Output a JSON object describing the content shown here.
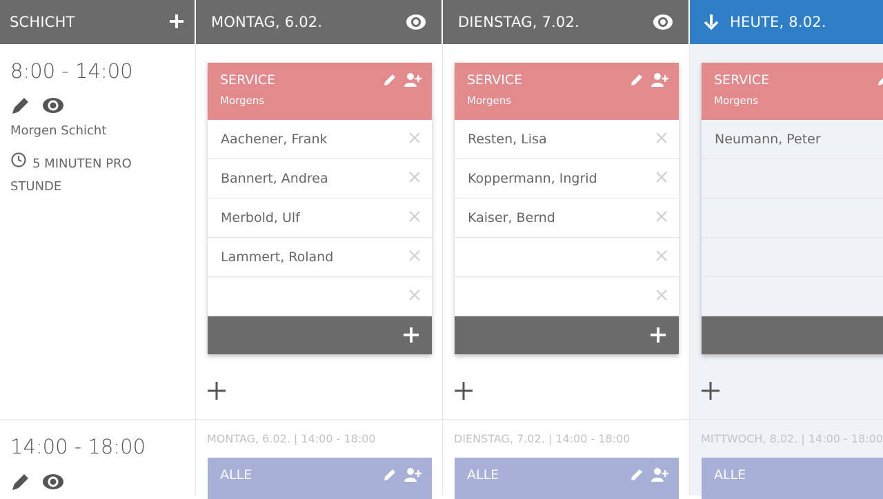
{
  "header": {
    "shift_col_label": "SCHICHT",
    "days": [
      {
        "label": "MONTAG, 6.02.",
        "icon": "eye-icon"
      },
      {
        "label": "DIENSTAG, 7.02.",
        "icon": "eye-icon"
      },
      {
        "label": "HEUTE, 8.02.",
        "icon": "arrow-down-icon",
        "is_today": true
      }
    ]
  },
  "colors": {
    "header_bg": "#6b6b6b",
    "today_bg": "#2f7fc8",
    "service_bg": "#e38a8d",
    "alle_bg": "#a8b0d8"
  },
  "shifts": [
    {
      "time": "8:00 - 14:00",
      "name": "Morgen Schicht",
      "rate_line1": "5 MINUTEN PRO",
      "rate_line2": "STUNDE"
    },
    {
      "time": "14:00 - 18:00"
    }
  ],
  "cards_row1": [
    {
      "title": "SERVICE",
      "subtitle": "Morgens",
      "slots": [
        "Aachener, Frank",
        "Bannert, Andrea",
        "Merbold, Ulf",
        "Lammert, Roland",
        ""
      ]
    },
    {
      "title": "SERVICE",
      "subtitle": "Morgens",
      "slots": [
        "Resten, Lisa",
        "Koppermann, Ingrid",
        "Kaiser, Bernd",
        "",
        ""
      ]
    },
    {
      "title": "SERVICE",
      "subtitle": "Morgens",
      "slots": [
        "Neumann, Peter",
        "",
        "",
        "",
        ""
      ]
    }
  ],
  "row2_labels": [
    "MONTAG, 6.02. | 14:00 - 18:00",
    "DIENSTAG, 7.02. | 14:00 - 18:00",
    "MITTWOCH, 8.02. | 14:00 - 18:00"
  ],
  "cards_row2": [
    {
      "title": "ALLE"
    },
    {
      "title": "ALLE"
    },
    {
      "title": "ALLE"
    }
  ]
}
